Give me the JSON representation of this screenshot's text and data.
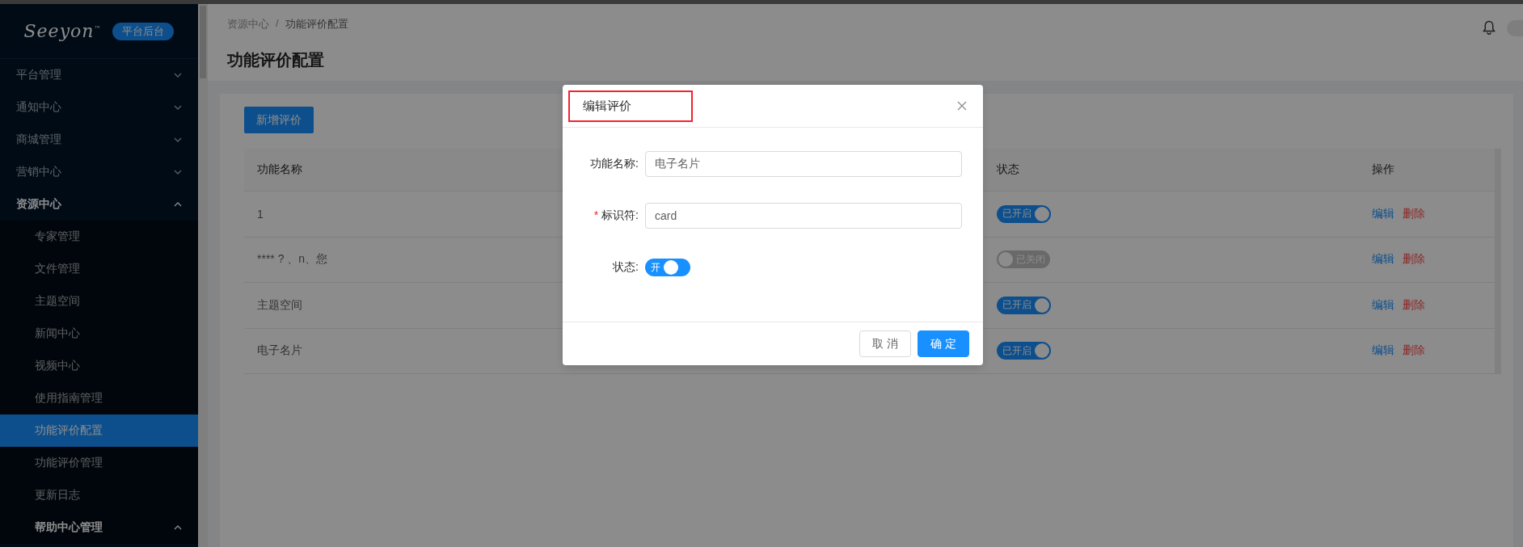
{
  "sidebar": {
    "logo": "Seeyon",
    "logo_mark": "™",
    "badge": "平台后台",
    "items": [
      {
        "label": "平台管理",
        "expanded": false,
        "selected": false
      },
      {
        "label": "通知中心",
        "expanded": false,
        "selected": false
      },
      {
        "label": "商城管理",
        "expanded": false,
        "selected": false
      },
      {
        "label": "营销中心",
        "expanded": false,
        "selected": false
      },
      {
        "label": "资源中心",
        "expanded": true,
        "selected": false,
        "children": [
          {
            "label": "专家管理",
            "selected": false
          },
          {
            "label": "文件管理",
            "selected": false
          },
          {
            "label": "主题空间",
            "selected": false
          },
          {
            "label": "新闻中心",
            "selected": false
          },
          {
            "label": "视频中心",
            "selected": false
          },
          {
            "label": "使用指南管理",
            "selected": false
          },
          {
            "label": "功能评价配置",
            "selected": true
          },
          {
            "label": "功能评价管理",
            "selected": false
          },
          {
            "label": "更新日志",
            "selected": false
          },
          {
            "label": "帮助中心管理",
            "expanded": true,
            "selected": false
          }
        ]
      }
    ]
  },
  "header": {
    "breadcrumb": [
      "资源中心",
      "功能评价配置"
    ],
    "breadcrumb_separator": "/",
    "title": "功能评价配置"
  },
  "toolbar": {
    "add_button": "新增评价"
  },
  "table": {
    "columns": [
      "功能名称",
      "状态",
      "操作"
    ],
    "rows": [
      {
        "name": "1",
        "on": true,
        "status": "已开启",
        "actions": [
          "编辑",
          "删除"
        ]
      },
      {
        "name": "**** ? 、n、您",
        "on": false,
        "status": "已关闭",
        "actions": [
          "编辑",
          "删除"
        ]
      },
      {
        "name": "主题空间",
        "on": true,
        "status": "已开启",
        "actions": [
          "编辑",
          "删除"
        ]
      },
      {
        "name": "电子名片",
        "on": true,
        "status": "已开启",
        "actions": [
          "编辑",
          "删除"
        ]
      }
    ]
  },
  "modal": {
    "title": "编辑评价",
    "title_highlighted": true,
    "required_mark": "*",
    "fields": [
      {
        "kind": "input",
        "label": "功能名称:",
        "required": false,
        "value": "电子名片"
      },
      {
        "kind": "input",
        "label": "标识符:",
        "required": true,
        "value": "card"
      },
      {
        "kind": "switch",
        "label": "状态:",
        "required": false,
        "on": true,
        "text": "开"
      }
    ],
    "buttons": [
      {
        "kind": "default",
        "label": "取 消"
      },
      {
        "kind": "primary",
        "label": "确 定"
      }
    ]
  }
}
